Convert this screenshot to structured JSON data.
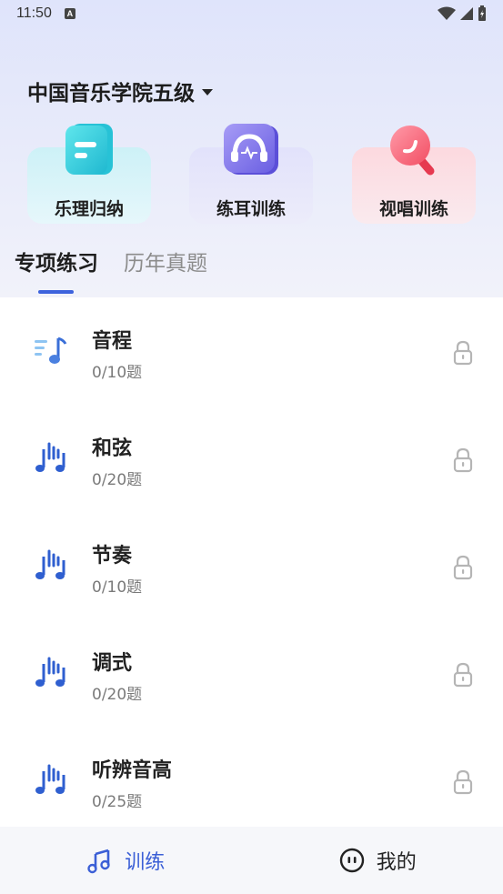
{
  "status_bar": {
    "time": "11:50",
    "badge": "A"
  },
  "header": {
    "school": "中国音乐学院五级"
  },
  "categories": [
    {
      "label": "乐理归纳",
      "icon": "theory-card-icon"
    },
    {
      "label": "练耳训练",
      "icon": "headphones-icon"
    },
    {
      "label": "视唱训练",
      "icon": "microphone-icon"
    }
  ],
  "tabs": [
    {
      "label": "专项练习",
      "active": true
    },
    {
      "label": "历年真题",
      "active": false
    }
  ],
  "items": [
    {
      "title": "音程",
      "count": "0/10题",
      "icon": "music-note-lines-icon",
      "locked": true
    },
    {
      "title": "和弦",
      "count": "0/20题",
      "icon": "music-notes-icon",
      "locked": true
    },
    {
      "title": "节奏",
      "count": "0/10题",
      "icon": "music-notes-icon",
      "locked": true
    },
    {
      "title": "调式",
      "count": "0/20题",
      "icon": "music-notes-icon",
      "locked": true
    },
    {
      "title": "听辨音高",
      "count": "0/25题",
      "icon": "music-notes-icon",
      "locked": true
    }
  ],
  "bottom_nav": [
    {
      "label": "训练",
      "icon": "music-note-icon",
      "active": true
    },
    {
      "label": "我的",
      "icon": "face-icon",
      "active": false
    }
  ],
  "colors": {
    "accent": "#3d63dd",
    "icon_blue": "#2f5fd0",
    "lock_gray": "#b5b5b5"
  }
}
